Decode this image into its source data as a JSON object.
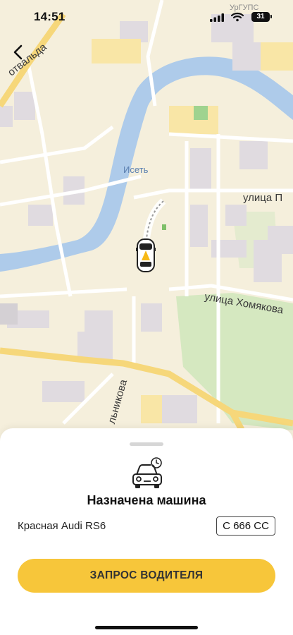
{
  "status_bar": {
    "time": "14:51",
    "carrier": "УрГУПС",
    "battery": "31"
  },
  "map": {
    "labels": {
      "river": "Исеть",
      "street_top_left": "отвальда",
      "street_right": "улица П",
      "street_khomyakova": "улица Хомякова",
      "street_bottom": "льникова"
    },
    "colors": {
      "land": "#f5efdc",
      "water": "#aecbea",
      "park": "#d5e8c0",
      "road_major": "#f6d77a",
      "building": "#e2dde0"
    }
  },
  "sheet": {
    "title": "Назначена машина",
    "car_model": "Красная Audi RS6",
    "plate": "С 666 СС",
    "request_button": "ЗАПРОС ВОДИТЕЛЯ"
  },
  "icons": {
    "back": "chevron-left-icon",
    "car_assigned": "car-clock-icon",
    "car_marker": "taxi-car-icon",
    "signal": "cell-signal-icon",
    "wifi": "wifi-icon",
    "battery": "battery-icon"
  },
  "colors": {
    "accent": "#f7c63a"
  }
}
